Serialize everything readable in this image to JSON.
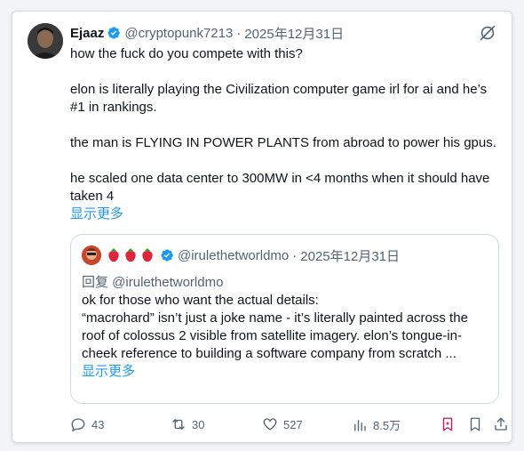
{
  "tweet": {
    "author_name": "Ejaaz",
    "handle": "@cryptopunk7213",
    "separator": "·",
    "date": "2025年12月31日",
    "paragraphs": [
      "how the fuck do you compete with this?",
      "elon is literally playing the Civilization computer game irl for ai and he’s #1 in rankings.",
      "the man is FLYING IN POWER PLANTS from abroad to power his gpus.",
      "he scaled one data center to 300MW in <4 months when it should have taken 4"
    ],
    "show_more": "显示更多"
  },
  "quote": {
    "handle": "@irulethetworldmo",
    "separator": "·",
    "date": "2025年12月31日",
    "reply_to": "回复 @irulethetworldmo",
    "line1": "ok for those who want the actual details:",
    "line2": "“macrohard” isn’t just a joke name - it’s literally painted across the roof of colossus 2 visible from satellite imagery. elon’s tongue-in-cheek reference to building a software company from scratch ...",
    "show_more": "显示更多"
  },
  "actions": {
    "replies": "43",
    "reposts": "30",
    "likes": "527",
    "views": "8.5万"
  },
  "colors": {
    "accent": "#1d9bf0",
    "secondary_text": "#536471",
    "bookmark_active": "#c2185b"
  }
}
